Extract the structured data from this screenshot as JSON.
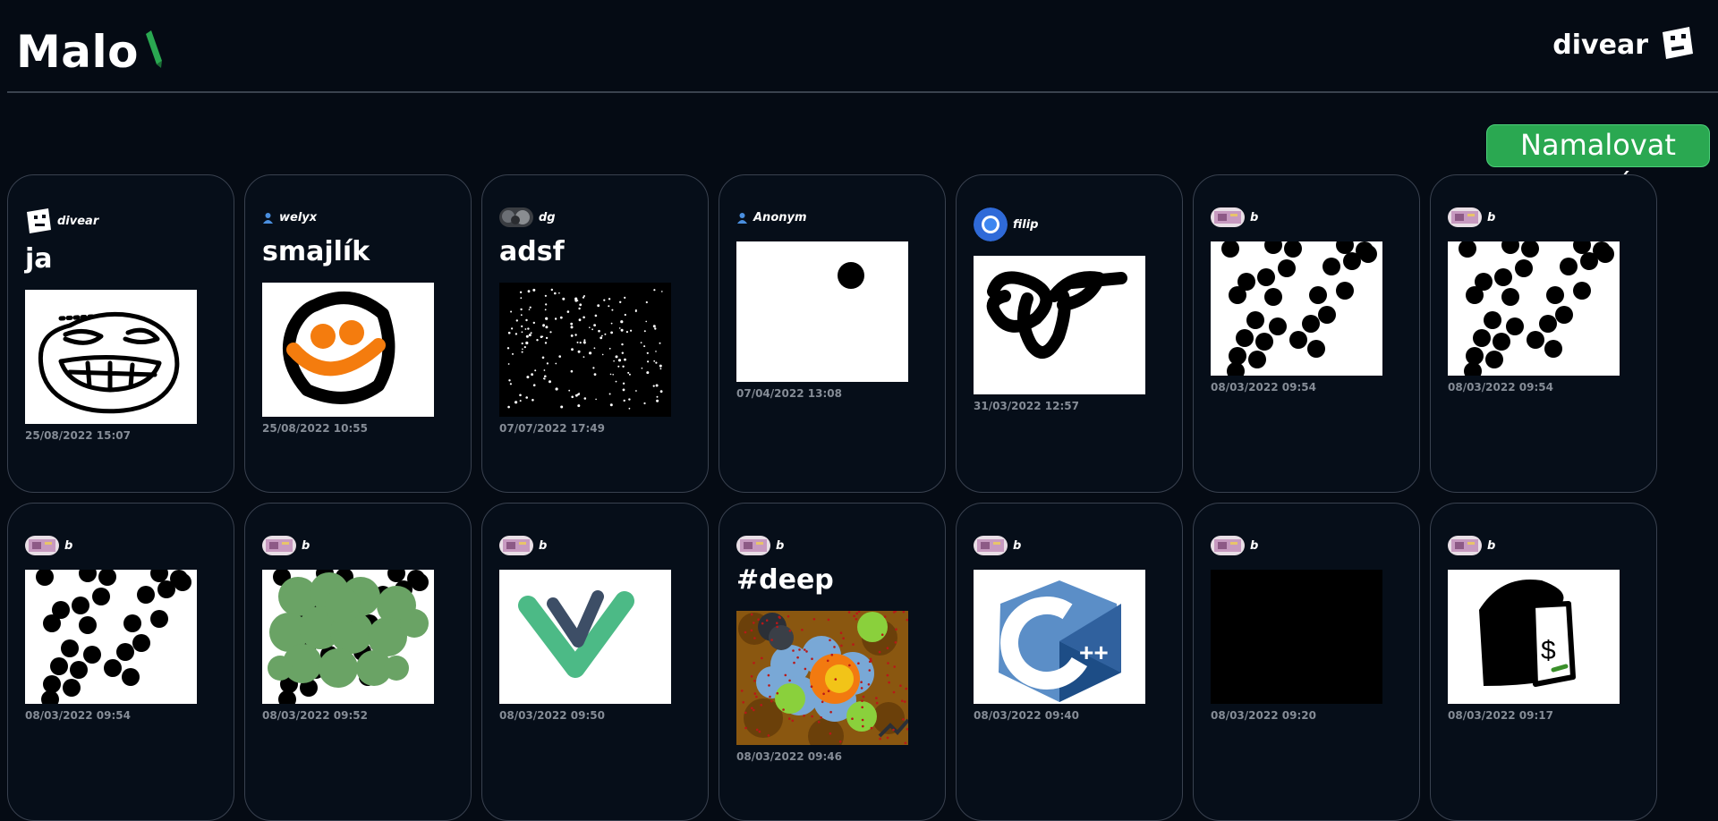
{
  "header": {
    "logo_text": "Malo",
    "user_name": "divear"
  },
  "new_button_label": "Namalovat nový",
  "cards": [
    {
      "author": "divear",
      "title": "ja",
      "date": "25/08/2022 15:07"
    },
    {
      "author": "welyx",
      "title": "smajlík",
      "date": "25/08/2022 10:55"
    },
    {
      "author": "dg",
      "title": "adsf",
      "date": "07/07/2022 17:49"
    },
    {
      "author": "Anonym",
      "title": "",
      "date": "07/04/2022 13:08"
    },
    {
      "author": "filip",
      "title": "",
      "date": "31/03/2022 12:57"
    },
    {
      "author": "b",
      "title": "",
      "date": "08/03/2022 09:54"
    },
    {
      "author": "b",
      "title": "",
      "date": "08/03/2022 09:54"
    },
    {
      "author": "b",
      "title": "",
      "date": "08/03/2022 09:54"
    },
    {
      "author": "b",
      "title": "",
      "date": "08/03/2022 09:52"
    },
    {
      "author": "b",
      "title": "",
      "date": "08/03/2022 09:50"
    },
    {
      "author": "b",
      "title": "#deep",
      "date": "08/03/2022 09:46"
    },
    {
      "author": "b",
      "title": "",
      "date": "08/03/2022 09:40"
    },
    {
      "author": "b",
      "title": "",
      "date": "08/03/2022 09:20"
    },
    {
      "author": "b",
      "title": "",
      "date": "08/03/2022 09:17"
    }
  ],
  "colors": {
    "background": "#050b14",
    "accent": "#2aa851",
    "card_border": "#39414f",
    "date_text": "#858c96"
  }
}
